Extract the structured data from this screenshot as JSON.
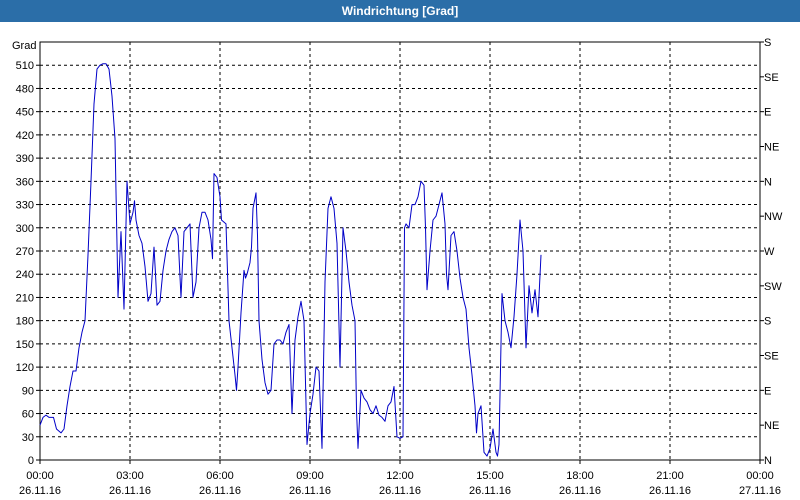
{
  "window": {
    "title": "Windrichtung [Grad]"
  },
  "chart_data": {
    "type": "line",
    "title": "Windrichtung [Grad]",
    "ylabel": "Grad",
    "ylim": [
      0,
      540
    ],
    "y_ticks": [
      0,
      30,
      60,
      90,
      120,
      150,
      180,
      210,
      240,
      270,
      300,
      330,
      360,
      390,
      420,
      450,
      480,
      510
    ],
    "right_ticks": [
      {
        "y": 0,
        "label": "N"
      },
      {
        "y": 45,
        "label": "NE"
      },
      {
        "y": 90,
        "label": "E"
      },
      {
        "y": 135,
        "label": "SE"
      },
      {
        "y": 180,
        "label": "S"
      },
      {
        "y": 225,
        "label": "SW"
      },
      {
        "y": 270,
        "label": "W"
      },
      {
        "y": 315,
        "label": "NW"
      },
      {
        "y": 360,
        "label": "N"
      },
      {
        "y": 405,
        "label": "NE"
      },
      {
        "y": 450,
        "label": "E"
      },
      {
        "y": 495,
        "label": "SE"
      },
      {
        "y": 540,
        "label": "S"
      }
    ],
    "xlim": [
      0,
      24
    ],
    "x_ticks": [
      {
        "x": 0,
        "time": "00:00",
        "date": "26.11.16"
      },
      {
        "x": 3,
        "time": "03:00",
        "date": "26.11.16"
      },
      {
        "x": 6,
        "time": "06:00",
        "date": "26.11.16"
      },
      {
        "x": 9,
        "time": "09:00",
        "date": "26.11.16"
      },
      {
        "x": 12,
        "time": "12:00",
        "date": "26.11.16"
      },
      {
        "x": 15,
        "time": "15:00",
        "date": "26.11.16"
      },
      {
        "x": 18,
        "time": "18:00",
        "date": "26.11.16"
      },
      {
        "x": 21,
        "time": "21:00",
        "date": "26.11.16"
      },
      {
        "x": 24,
        "time": "00:00",
        "date": "27.11.16"
      }
    ],
    "grid": true,
    "line_color": "#0000c8",
    "series": [
      {
        "values": [
          [
            0.0,
            45
          ],
          [
            0.1,
            55
          ],
          [
            0.2,
            58
          ],
          [
            0.3,
            55
          ],
          [
            0.45,
            55
          ],
          [
            0.55,
            40
          ],
          [
            0.7,
            35
          ],
          [
            0.8,
            40
          ],
          [
            0.9,
            70
          ],
          [
            1.0,
            95
          ],
          [
            1.1,
            115
          ],
          [
            1.2,
            115
          ],
          [
            1.3,
            145
          ],
          [
            1.4,
            165
          ],
          [
            1.5,
            180
          ],
          [
            1.6,
            265
          ],
          [
            1.7,
            360
          ],
          [
            1.8,
            460
          ],
          [
            1.9,
            505
          ],
          [
            2.0,
            510
          ],
          [
            2.1,
            512
          ],
          [
            2.2,
            512
          ],
          [
            2.3,
            505
          ],
          [
            2.4,
            470
          ],
          [
            2.5,
            415
          ],
          [
            2.6,
            210
          ],
          [
            2.7,
            295
          ],
          [
            2.8,
            195
          ],
          [
            2.9,
            360
          ],
          [
            3.0,
            305
          ],
          [
            3.1,
            320
          ],
          [
            3.15,
            335
          ],
          [
            3.2,
            310
          ],
          [
            3.3,
            290
          ],
          [
            3.4,
            280
          ],
          [
            3.5,
            250
          ],
          [
            3.6,
            205
          ],
          [
            3.7,
            215
          ],
          [
            3.8,
            275
          ],
          [
            3.85,
            240
          ],
          [
            3.9,
            200
          ],
          [
            4.0,
            205
          ],
          [
            4.1,
            245
          ],
          [
            4.2,
            270
          ],
          [
            4.3,
            285
          ],
          [
            4.4,
            295
          ],
          [
            4.5,
            300
          ],
          [
            4.6,
            290
          ],
          [
            4.7,
            210
          ],
          [
            4.8,
            295
          ],
          [
            4.9,
            300
          ],
          [
            5.0,
            305
          ],
          [
            5.1,
            210
          ],
          [
            5.2,
            230
          ],
          [
            5.3,
            300
          ],
          [
            5.4,
            320
          ],
          [
            5.5,
            320
          ],
          [
            5.6,
            310
          ],
          [
            5.7,
            285
          ],
          [
            5.75,
            260
          ],
          [
            5.8,
            370
          ],
          [
            5.9,
            365
          ],
          [
            6.0,
            340
          ],
          [
            6.05,
            310
          ],
          [
            6.2,
            305
          ],
          [
            6.3,
            180
          ],
          [
            6.4,
            145
          ],
          [
            6.5,
            110
          ],
          [
            6.55,
            90
          ],
          [
            6.6,
            120
          ],
          [
            6.7,
            190
          ],
          [
            6.8,
            245
          ],
          [
            6.85,
            235
          ],
          [
            6.9,
            240
          ],
          [
            7.0,
            255
          ],
          [
            7.05,
            275
          ],
          [
            7.1,
            325
          ],
          [
            7.2,
            345
          ],
          [
            7.25,
            290
          ],
          [
            7.3,
            180
          ],
          [
            7.4,
            130
          ],
          [
            7.5,
            100
          ],
          [
            7.6,
            85
          ],
          [
            7.7,
            90
          ],
          [
            7.8,
            150
          ],
          [
            7.9,
            155
          ],
          [
            8.0,
            155
          ],
          [
            8.1,
            150
          ],
          [
            8.2,
            165
          ],
          [
            8.3,
            175
          ],
          [
            8.4,
            60
          ],
          [
            8.5,
            155
          ],
          [
            8.6,
            185
          ],
          [
            8.7,
            205
          ],
          [
            8.8,
            180
          ],
          [
            8.9,
            20
          ],
          [
            9.0,
            60
          ],
          [
            9.1,
            85
          ],
          [
            9.2,
            120
          ],
          [
            9.3,
            115
          ],
          [
            9.4,
            15
          ],
          [
            9.5,
            230
          ],
          [
            9.6,
            325
          ],
          [
            9.7,
            340
          ],
          [
            9.8,
            325
          ],
          [
            9.9,
            280
          ],
          [
            10.0,
            120
          ],
          [
            10.1,
            300
          ],
          [
            10.2,
            270
          ],
          [
            10.3,
            230
          ],
          [
            10.4,
            200
          ],
          [
            10.5,
            180
          ],
          [
            10.55,
            65
          ],
          [
            10.6,
            15
          ],
          [
            10.7,
            90
          ],
          [
            10.8,
            80
          ],
          [
            10.9,
            75
          ],
          [
            11.0,
            65
          ],
          [
            11.1,
            60
          ],
          [
            11.2,
            70
          ],
          [
            11.3,
            58
          ],
          [
            11.4,
            55
          ],
          [
            11.5,
            50
          ],
          [
            11.6,
            70
          ],
          [
            11.7,
            75
          ],
          [
            11.8,
            95
          ],
          [
            11.9,
            30
          ],
          [
            12.0,
            28
          ],
          [
            12.1,
            30
          ],
          [
            12.15,
            300
          ],
          [
            12.2,
            305
          ],
          [
            12.3,
            300
          ],
          [
            12.4,
            330
          ],
          [
            12.5,
            330
          ],
          [
            12.6,
            340
          ],
          [
            12.7,
            360
          ],
          [
            12.8,
            355
          ],
          [
            12.85,
            300
          ],
          [
            12.9,
            220
          ],
          [
            13.0,
            270
          ],
          [
            13.1,
            310
          ],
          [
            13.2,
            315
          ],
          [
            13.3,
            330
          ],
          [
            13.4,
            345
          ],
          [
            13.5,
            305
          ],
          [
            13.55,
            240
          ],
          [
            13.6,
            220
          ],
          [
            13.7,
            290
          ],
          [
            13.8,
            295
          ],
          [
            13.9,
            270
          ],
          [
            14.0,
            235
          ],
          [
            14.1,
            210
          ],
          [
            14.2,
            195
          ],
          [
            14.3,
            145
          ],
          [
            14.4,
            110
          ],
          [
            14.5,
            70
          ],
          [
            14.55,
            35
          ],
          [
            14.6,
            60
          ],
          [
            14.7,
            70
          ],
          [
            14.75,
            40
          ],
          [
            14.8,
            10
          ],
          [
            14.9,
            5
          ],
          [
            15.0,
            15
          ],
          [
            15.1,
            40
          ],
          [
            15.2,
            10
          ],
          [
            15.25,
            5
          ],
          [
            15.3,
            20
          ],
          [
            15.4,
            215
          ],
          [
            15.5,
            180
          ],
          [
            15.6,
            165
          ],
          [
            15.7,
            145
          ],
          [
            15.8,
            185
          ],
          [
            15.9,
            240
          ],
          [
            16.0,
            310
          ],
          [
            16.1,
            270
          ],
          [
            16.2,
            145
          ],
          [
            16.3,
            225
          ],
          [
            16.4,
            190
          ],
          [
            16.5,
            220
          ],
          [
            16.6,
            185
          ],
          [
            16.7,
            265
          ]
        ]
      }
    ]
  }
}
